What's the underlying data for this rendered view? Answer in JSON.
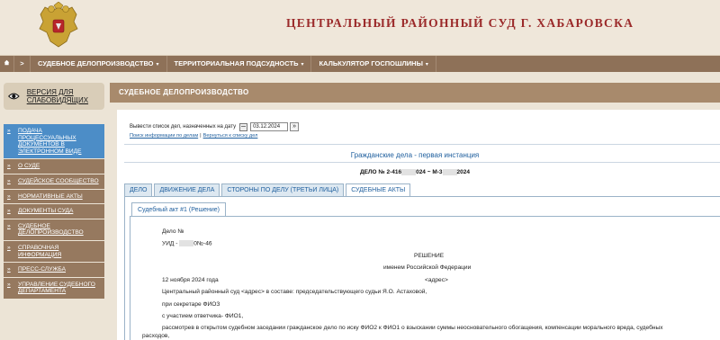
{
  "header": {
    "court_title": "ЦЕНТРАЛЬНЫЙ РАЙОННЫЙ СУД Г. ХАБАРОВСКА"
  },
  "topnav": {
    "home_icon": "home-icon",
    "arrow": ">",
    "items": [
      {
        "label": "СУДЕБНОЕ ДЕЛОПРОИЗВОДСТВО"
      },
      {
        "label": "ТЕРРИТОРИАЛЬНАЯ ПОДСУДНОСТЬ"
      },
      {
        "label": "КАЛЬКУЛЯТОР ГОСПОШЛИНЫ"
      }
    ]
  },
  "sidebar": {
    "vision_label": "ВЕРСИЯ ДЛЯ СЛАБОВИДЯЩИХ",
    "items": [
      {
        "label": "ПОДАЧА ПРОЦЕССУАЛЬНЫХ ДОКУМЕНТОВ В ЭЛЕКТРОННОМ ВИДЕ"
      },
      {
        "label": "О СУДЕ"
      },
      {
        "label": "СУДЕЙСКОЕ СООБЩЕСТВО"
      },
      {
        "label": "НОРМАТИВНЫЕ АКТЫ"
      },
      {
        "label": "ДОКУМЕНТЫ СУДА"
      },
      {
        "label": "СУДЕБНОЕ ДЕЛОПРОИЗВОДСТВО"
      },
      {
        "label": "СПРАВОЧНАЯ ИНФОРМАЦИЯ"
      },
      {
        "label": "ПРЕСС-СЛУЖБА"
      },
      {
        "label": "УПРАВЛЕНИЕ СУДЕБНОГО ДЕПАРТАМЕНТА"
      }
    ]
  },
  "main": {
    "band_title": "СУДЕБНОЕ ДЕЛОПРОИЗВОДСТВО",
    "date_label": "Вывести список дел, назначенных на дату",
    "date_value": "03.12.2024",
    "go_label": "»",
    "link_search": "Поиск информации по делам",
    "link_sep": "|",
    "link_back": "Вернуться к списку дел",
    "instance": "Гражданские дела - первая инстанция",
    "case_prefix": "ДЕЛО № 2-416",
    "case_mid": "024 ~ М-3",
    "case_suffix": "2024",
    "tabs": [
      {
        "label": "ДЕЛО"
      },
      {
        "label": "ДВИЖЕНИЕ ДЕЛА"
      },
      {
        "label": "СТОРОНЫ ПО ДЕЛУ (ТРЕТЬИ ЛИЦА)"
      },
      {
        "label": "СУДЕБНЫЕ АКТЫ"
      }
    ],
    "subtab": "Судебный акт #1 (Решение)"
  },
  "document": {
    "delo": "Дело №",
    "uid_prefix": "УИД -",
    "uid_suffix": "0№-46",
    "title": "РЕШЕНИЕ",
    "subtitle": "именем Российской Федерации",
    "date": "12 ноября 2024 года",
    "address": "<адрес>",
    "line1": "Центральный районный суд <адрес> в составе: председательствующего судьи Я.О. Астаховой,",
    "line2": "при секретаре ФИОЗ",
    "line3": "с участием ответчика- ФИО1,",
    "line4": "рассмотрев в открытом судебном заседании гражданское дело по иску ФИО2 к ФИО1 о взыскании суммы неосновательного обогащения, компенсации морального вреда, судебных",
    "line5": "расходов,"
  },
  "colors": {
    "court_title": "#9b2a2a",
    "nav_bg": "#8e7158",
    "sidebar_item": "#96795f",
    "sidebar_active": "#4c8dc7",
    "band": "#a88a6c",
    "link": "#1f5f9e"
  }
}
